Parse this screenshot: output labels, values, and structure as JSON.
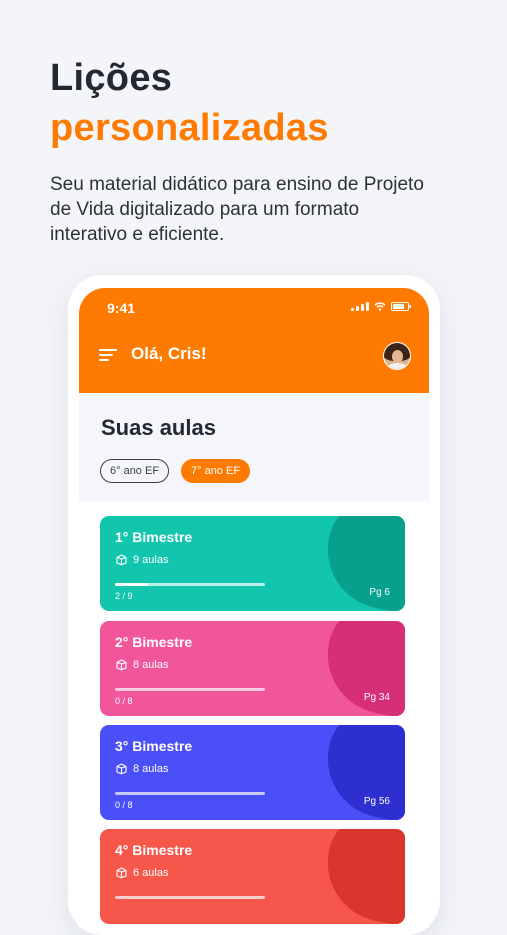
{
  "hero": {
    "title_line1": "Lições",
    "title_line2": "personalizadas",
    "subtitle": "Seu material didático para ensino de Projeto de Vida digitalizado para um formato interativo e eficiente."
  },
  "status_bar": {
    "time": "9:41"
  },
  "header": {
    "greeting": "Olá, Cris!"
  },
  "section": {
    "title": "Suas aulas",
    "chips": [
      {
        "label": "6° ano EF",
        "selected": false
      },
      {
        "label": "7° ano EF",
        "selected": true
      }
    ]
  },
  "cards": [
    {
      "title": "1° Bimestre",
      "lessons": "9 aulas",
      "progress_text": "2 / 9",
      "progress": 0.22,
      "page": "Pg 6",
      "color": "#11c6ad",
      "accent": "#06a08c"
    },
    {
      "title": "2° Bimestre",
      "lessons": "8 aulas",
      "progress_text": "0 / 8",
      "progress": 0,
      "page": "Pg 34",
      "color": "#f2569a",
      "accent": "#d62f78"
    },
    {
      "title": "3° Bimestre",
      "lessons": "8 aulas",
      "progress_text": "0 / 8",
      "progress": 0,
      "page": "Pg 56",
      "color": "#4b4ff7",
      "accent": "#2d2fd0"
    },
    {
      "title": "4° Bimestre",
      "lessons": "6 aulas",
      "progress_text": "",
      "progress": 0,
      "page": "",
      "color": "#f7574a",
      "accent": "#d9362c"
    }
  ],
  "colors": {
    "brand_orange": "#ff7a00",
    "background": "#f3f5f9",
    "text_dark": "#252833"
  }
}
